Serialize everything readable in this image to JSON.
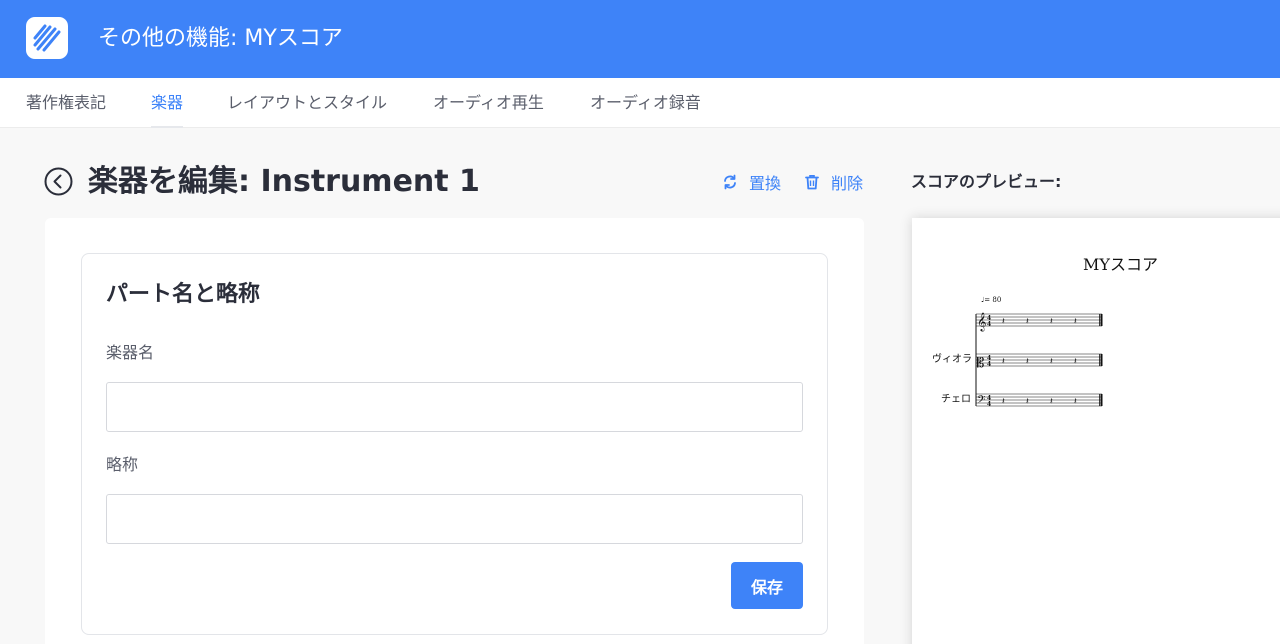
{
  "app": {
    "title": "その他の機能: MYスコア",
    "logo_icon": "slashes-logo-icon"
  },
  "tabs": [
    {
      "label": "著作権表記",
      "active": false
    },
    {
      "label": "楽器",
      "active": true
    },
    {
      "label": "レイアウトとスタイル",
      "active": false
    },
    {
      "label": "オーディオ再生",
      "active": false
    },
    {
      "label": "オーディオ録音",
      "active": false
    }
  ],
  "page": {
    "title": "楽器を編集: Instrument 1",
    "back_icon": "back-circle-icon"
  },
  "actions": {
    "replace_label": "置換",
    "replace_icon": "refresh-icon",
    "delete_label": "削除",
    "delete_icon": "trash-icon"
  },
  "form": {
    "card_title": "パート名と略称",
    "instrument_name_label": "楽器名",
    "instrument_name_value": "",
    "abbreviation_label": "略称",
    "abbreviation_value": "",
    "save_label": "保存"
  },
  "preview": {
    "label": "スコアのプレビュー:",
    "score_title": "MYスコア",
    "tempo": "♩= 80",
    "staves": [
      {
        "name": "",
        "clef": "treble"
      },
      {
        "name": "ヴィオラ",
        "clef": "alto"
      },
      {
        "name": "チェロ",
        "clef": "bass"
      }
    ]
  },
  "colors": {
    "primary": "#3e83f8",
    "text": "#2b2e3a",
    "muted": "#5a5e6b"
  }
}
